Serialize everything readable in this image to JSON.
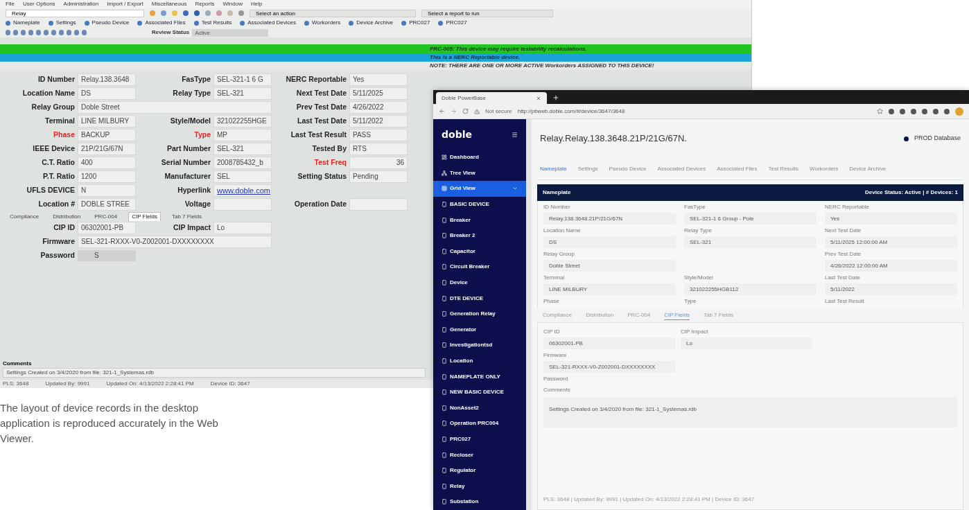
{
  "desktop": {
    "menu": [
      "File",
      "User Options",
      "Administration",
      "Import / Export",
      "Miscellaneous",
      "Reports",
      "Window",
      "Help"
    ],
    "view_select": "Relay",
    "action_select": "Select an action",
    "report_select": "Select a report to run",
    "toolbar_tabs": [
      "Nameplate",
      "Settings",
      "Pseudo Device",
      "Associated Files",
      "Test Results",
      "Associated Devices",
      "Workorders",
      "Device Archive",
      "PRC027",
      "PRC027"
    ],
    "review_status": {
      "label": "Review Status",
      "value": "Active"
    },
    "banners": [
      {
        "kind": "green",
        "text": "PRC-005: This device may require testability recalculations."
      },
      {
        "kind": "blue",
        "text": "This is a NERC Reportable device."
      },
      {
        "kind": "note",
        "text": "NOTE:  THERE ARE ONE OR MORE ACTIVE Workorders ASSIGNED TO THIS DEVICE!"
      }
    ],
    "rows": [
      {
        "left": {
          "label": "ID Number",
          "value": "Relay.138.3648",
          "highlight": false
        },
        "middle": {
          "label": "FasType",
          "value": "SEL-321-1 6 G",
          "highlight": false
        },
        "right": {
          "label": "NERC Reportable",
          "value": "Yes",
          "highlight": false
        }
      },
      {
        "left": {
          "label": "Location Name",
          "value": "DS",
          "highlight": false
        },
        "middle": {
          "label": "Relay Type",
          "value": "SEL-321",
          "highlight": false
        },
        "right": {
          "label": "Next Test Date",
          "value": "5/11/2025",
          "highlight": false
        }
      },
      {
        "left": {
          "label": "Relay Group",
          "value": "Doble Street",
          "highlight": false,
          "kind": "wide"
        },
        "right": {
          "label": "Prev Test Date",
          "value": "4/26/2022",
          "highlight": false
        }
      },
      {
        "left": {
          "label": "Terminal",
          "value": "LINE MILBURY",
          "highlight": false
        },
        "middle": {
          "label": "Style/Model",
          "value": "321022255HGE",
          "highlight": false
        },
        "right": {
          "label": "Last Test Date",
          "value": "5/11/2022",
          "highlight": false
        }
      },
      {
        "left": {
          "label": "Phase",
          "value": "BACKUP",
          "highlight": true
        },
        "middle": {
          "label": "Type",
          "value": "MP",
          "highlight": true
        },
        "right": {
          "label": "Last Test Result",
          "value": "PASS",
          "highlight": false
        }
      },
      {
        "left": {
          "label": "IEEE Device",
          "value": "21P/21G/67N",
          "highlight": false
        },
        "middle": {
          "label": "Part Number",
          "value": "SEL-321",
          "highlight": false
        },
        "right": {
          "label": "Tested By",
          "value": "RTS",
          "highlight": false
        }
      },
      {
        "left": {
          "label": "C.T. Ratio",
          "value": "400",
          "highlight": false
        },
        "middle": {
          "label": "Serial Number",
          "value": "2008785432_b",
          "highlight": false
        },
        "right": {
          "label": "Test Freq",
          "value": "36",
          "highlight": true,
          "kind": "number"
        }
      },
      {
        "left": {
          "label": "P.T. Ratio",
          "value": "1200",
          "highlight": false
        },
        "middle": {
          "label": "Manufacturer",
          "value": "SEL",
          "highlight": false
        },
        "right": {
          "label": "Setting Status",
          "value": "Pending",
          "highlight": false
        }
      },
      {
        "left": {
          "label": "UFLS DEVICE",
          "value": "N",
          "highlight": false
        },
        "middle": {
          "label": "Hyperlink",
          "value": "www.doble.com",
          "highlight": false,
          "kind": "link"
        }
      },
      {
        "left": {
          "label": "Location #",
          "value": "DOBLE STREE",
          "highlight": false
        },
        "middle": {
          "label": "Voltage",
          "highlight": false
        },
        "right": {
          "label": "Operation Date",
          "highlight": false
        }
      }
    ],
    "subtabs": [
      {
        "label": "Compliance",
        "selected": false
      },
      {
        "label": "Distribution",
        "selected": false
      },
      {
        "label": "PRC-004",
        "selected": false
      },
      {
        "label": "CIP Fields",
        "selected": true
      },
      {
        "label": "Tab 7 Fields",
        "selected": false
      }
    ],
    "cip_rows": [
      {
        "left": {
          "label": "CIP ID",
          "value": "06302001-PB",
          "highlight": false
        },
        "middle": {
          "label": "CIP Impact",
          "value": "Lo",
          "highlight": false
        }
      },
      {
        "left": {
          "label": "Firmware",
          "value": "SEL-321-RXXX-V0-Z002001-DXXXXXXXX",
          "highlight": false,
          "kind": "wide"
        }
      },
      {
        "left": {
          "label": "Password",
          "value": "S",
          "highlight": false,
          "kind": "masked"
        }
      }
    ],
    "comments": {
      "label": "Comments",
      "value": "Settings Created on 3/4/2020 from file: 321-1_Systemas.rdb"
    },
    "status_bar": [
      "PLS: 3648",
      "Updated By: 9991",
      "Updated On: 4/13/2022 2:28:41 PM",
      "Device ID: 3647"
    ]
  },
  "browser": {
    "tab_title": "Doble PowerBase",
    "security": "Not secure",
    "url": "http://pbweb.doble.com/#/device/3647/3648",
    "logo": "doble",
    "sidebar": [
      {
        "label": "Dashboard",
        "selected": false
      },
      {
        "label": "Tree View",
        "selected": false
      },
      {
        "label": "Grid View",
        "selected": true,
        "expanded": true
      },
      {
        "label": "BASIC DEVICE",
        "selected": false
      },
      {
        "label": "Breaker",
        "selected": false
      },
      {
        "label": "Breaker 2",
        "selected": false
      },
      {
        "label": "Capacitor",
        "selected": false
      },
      {
        "label": "Circuit Breaker",
        "selected": false
      },
      {
        "label": "Device",
        "selected": false
      },
      {
        "label": "DTE DEVICE",
        "selected": false
      },
      {
        "label": "Generation Relay",
        "selected": false
      },
      {
        "label": "Generator",
        "selected": false
      },
      {
        "label": "Investigationtsd",
        "selected": false
      },
      {
        "label": "Location",
        "selected": false
      },
      {
        "label": "NAMEPLATE ONLY",
        "selected": false
      },
      {
        "label": "NEW BASIC DEVICE",
        "selected": false
      },
      {
        "label": "NonAsset2",
        "selected": false
      },
      {
        "label": "Operation PRC004",
        "selected": false
      },
      {
        "label": "PRC027",
        "selected": false
      },
      {
        "label": "Recloser",
        "selected": false
      },
      {
        "label": "Regulator",
        "selected": false
      },
      {
        "label": "Relay",
        "selected": false
      },
      {
        "label": "Substation",
        "selected": false
      }
    ],
    "title": "Relay.Relay.138.3648.21P/21G/67N.",
    "database": "PROD Database",
    "tabs": [
      {
        "label": "Nameplate",
        "selected": true
      },
      {
        "label": "Settings",
        "selected": false
      },
      {
        "label": "Pseudo Device",
        "selected": false
      },
      {
        "label": "Associated Devices",
        "selected": false
      },
      {
        "label": "Associated Files",
        "selected": false
      },
      {
        "label": "Test Results",
        "selected": false
      },
      {
        "label": "Workorders",
        "selected": false
      },
      {
        "label": "Device Archive",
        "selected": false
      }
    ],
    "panel_title": "Nameplate",
    "panel_status": "Device Status: Active | # Devices: 1",
    "rows": [
      {
        "left": {
          "label": "ID Number",
          "value": "Relay.138.3648.21P/21G/67N"
        },
        "middle": {
          "label": "FasType",
          "value": "SEL-321-1 6 Group - Pole"
        },
        "right": {
          "label": "NERC Reportable",
          "value": "Yes"
        }
      },
      {
        "left": {
          "label": "Location Name",
          "value": "DS"
        },
        "middle": {
          "label": "Relay Type",
          "value": "SEL-321"
        },
        "right": {
          "label": "Next Test Date",
          "value": "5/11/2025 12:00:00 AM"
        }
      },
      {
        "left": {
          "label": "Relay Group",
          "value": "Doble Street"
        },
        "right": {
          "label": "Prev Test Date",
          "value": "4/26/2022 12:00:00 AM"
        }
      },
      {
        "left": {
          "label": "Terminal",
          "value": "LINE MILBURY"
        },
        "middle": {
          "label": "Style/Model",
          "value": "321022255HGB112"
        },
        "right": {
          "label": "Last Test Date",
          "value": "5/11/2022"
        }
      },
      {
        "left": {
          "label": "Phase"
        },
        "middle": {
          "label": "Type"
        },
        "right": {
          "label": "Last Test Result"
        }
      }
    ],
    "subtabs": [
      {
        "label": "Compliance",
        "selected": false
      },
      {
        "label": "Distribution",
        "selected": false
      },
      {
        "label": "PRC-004",
        "selected": false
      },
      {
        "label": "CIP Fields",
        "selected": true
      },
      {
        "label": "Tab 7 Fields",
        "selected": false
      }
    ],
    "cip_rows": [
      {
        "left": {
          "label": "CIP ID",
          "value": "06302001-PB"
        },
        "middle": {
          "label": "CIP Impact",
          "value": "Lo"
        }
      },
      {
        "left": {
          "label": "Firmware",
          "value": "SEL-321-RXXX-V0-Z002001-DXXXXXXXX"
        }
      },
      {
        "left": {
          "label": "Password"
        }
      }
    ],
    "comments": {
      "label": "Comments",
      "value": "Settings Created on 3/4/2020 from file: 321-1_Systemas.rdb"
    },
    "footer": "PLS: 3648 | Updated By: 9991 | Updated On: 4/13/2022 2:28:41 PM | Device ID: 3647"
  },
  "caption": "The layout of device records in the desktop application is reproduced accurately in the Web Viewer."
}
